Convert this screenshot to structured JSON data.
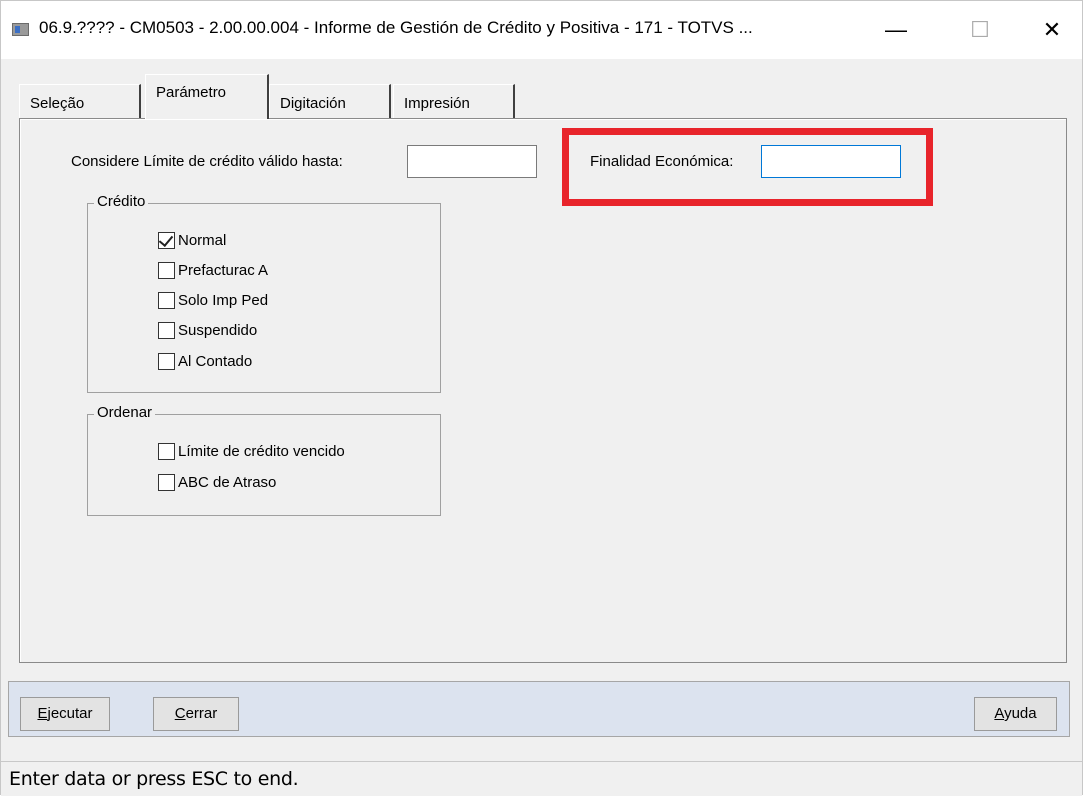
{
  "window": {
    "title": "06.9.???? - CM0503 - 2.00.00.004 - Informe de Gestión de Crédito y Positiva - 171 - TOTVS ...",
    "minimize_glyph": "—",
    "maximize_glyph": "☐",
    "close_glyph": "✕"
  },
  "tabs": [
    {
      "label": "Seleção",
      "active": false
    },
    {
      "label": "Parámetro",
      "active": true
    },
    {
      "label": "Digitación",
      "active": false
    },
    {
      "label": "Impresión",
      "active": false
    }
  ],
  "form": {
    "credit_limit_label": "Considere Límite de crédito válido hasta:",
    "credit_limit_value": "",
    "purpose_label": "Finalidad Económica:",
    "purpose_value": ""
  },
  "credito_group": {
    "title": "Crédito",
    "items": [
      {
        "label": "Normal",
        "checked": true
      },
      {
        "label": "Prefacturac A",
        "checked": false
      },
      {
        "label": "Solo Imp Ped",
        "checked": false
      },
      {
        "label": "Suspendido",
        "checked": false
      },
      {
        "label": "Al Contado",
        "checked": false
      }
    ]
  },
  "ordenar_group": {
    "title": "Ordenar",
    "items": [
      {
        "label": "Límite de crédito vencido",
        "checked": false
      },
      {
        "label": "ABC de Atraso",
        "checked": false
      }
    ]
  },
  "buttons": {
    "execute": {
      "mnemonic": "E",
      "rest": "jecutar"
    },
    "close": {
      "mnemonic": "C",
      "rest": "errar"
    },
    "help": {
      "mnemonic": "A",
      "rest": "yuda"
    }
  },
  "status": "Enter data or press ESC to end.",
  "colors": {
    "highlight": "#e8242b",
    "focus_border": "#0078d7",
    "button_bar": "#dce3ef"
  }
}
